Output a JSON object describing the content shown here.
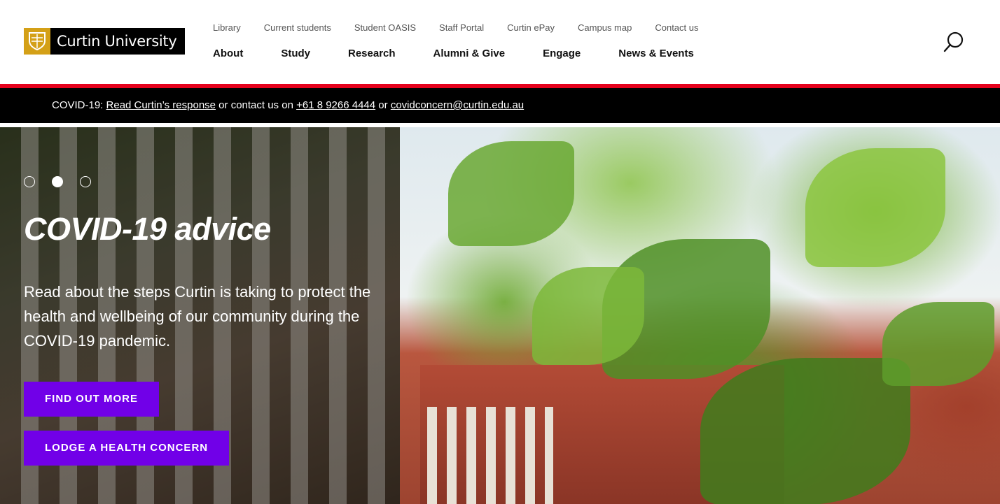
{
  "header": {
    "logo_text": "Curtin University",
    "utility_links": [
      "Library",
      "Current students",
      "Student OASIS",
      "Staff Portal",
      "Curtin ePay",
      "Campus map",
      "Contact us"
    ],
    "main_nav": [
      "About",
      "Study",
      "Research",
      "Alumni & Give",
      "Engage",
      "News & Events"
    ],
    "search_icon": "search-icon"
  },
  "alert": {
    "prefix": "COVID-19: ",
    "link_response": "Read Curtin’s response",
    "middle": " or contact us on ",
    "phone": "+61 8 9266 4444",
    "or": " or ",
    "email": "covidconcern@curtin.edu.au"
  },
  "hero": {
    "slides": 3,
    "active_slide": 2,
    "title": "COVID-19 advice",
    "text": "Read about the steps Curtin is taking to protect the health and wellbeing of our community during the COVID-19 pandemic.",
    "primary_button": "FIND OUT MORE",
    "secondary_button": "LODGE A HEALTH CONCERN"
  },
  "colors": {
    "brand_gold": "#d4a017",
    "accent_red": "#e4001b",
    "button_purple": "#7100e8"
  }
}
